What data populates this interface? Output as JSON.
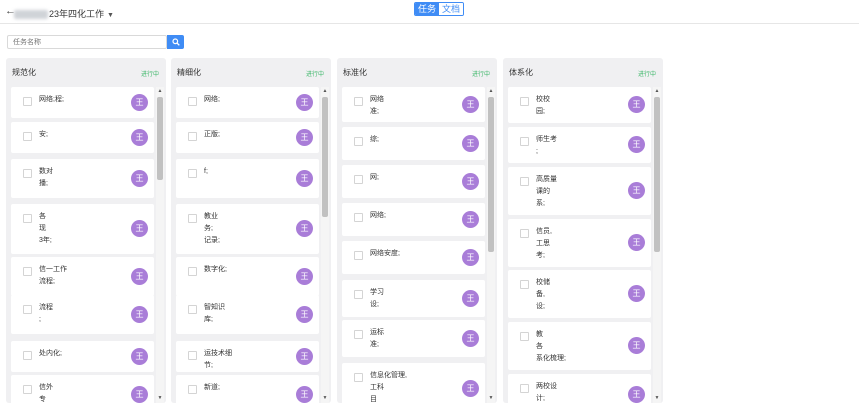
{
  "header": {
    "back_glyph": "←",
    "title_visible": "23年四化工作",
    "title_caret": "▼",
    "tabs": [
      {
        "label": "任务",
        "active": true
      },
      {
        "label": "文档",
        "active": false
      }
    ]
  },
  "search": {
    "placeholder": "任务名称",
    "button_icon": "search-icon"
  },
  "colors": {
    "accent": "#3f8cf5",
    "status_green": "#3fb86b",
    "avatar_purple": "#a97dd8",
    "column_bg": "#f0f0f2"
  },
  "columns": [
    {
      "title": "规范化",
      "status": "进行中",
      "cards": [
        {
          "lines": [
            "网络;程;"
          ],
          "avatar": "王"
        },
        {
          "lines": [
            "安;"
          ],
          "avatar": "王"
        },
        {
          "lines": [
            "数对",
            "播;"
          ],
          "avatar": "王"
        },
        {
          "lines": [
            "各",
            "现",
            "3年;"
          ],
          "avatar": "王"
        },
        {
          "lines": [
            "信一工作",
            "流程;"
          ],
          "avatar": "王"
        },
        {
          "lines": [
            "流程",
            ";"
          ],
          "avatar": "王"
        },
        {
          "lines": [
            "处内化;"
          ],
          "avatar": "王"
        },
        {
          "lines": [
            "信外",
            "专"
          ],
          "avatar": "王"
        }
      ]
    },
    {
      "title": "精细化",
      "status": "进行中",
      "cards": [
        {
          "lines": [
            "网络;"
          ],
          "avatar": "王"
        },
        {
          "lines": [
            "正版;"
          ],
          "avatar": "王"
        },
        {
          "lines": [
            "f;"
          ],
          "avatar": "王"
        },
        {
          "lines": [
            "教业",
            "务;",
            "记录;"
          ],
          "avatar": "王"
        },
        {
          "lines": [
            "数字化;"
          ],
          "avatar": "王"
        },
        {
          "lines": [
            "智知识",
            "库;"
          ],
          "avatar": "王"
        },
        {
          "lines": [
            "运技术细",
            "节;"
          ],
          "avatar": "王"
        },
        {
          "lines": [
            "新道;"
          ],
          "avatar": "王"
        }
      ]
    },
    {
      "title": "标准化",
      "status": "进行中",
      "cards": [
        {
          "lines": [
            "网络",
            "准;"
          ],
          "avatar": "王"
        },
        {
          "lines": [
            "综;"
          ],
          "avatar": "王"
        },
        {
          "lines": [
            "网;"
          ],
          "avatar": "王"
        },
        {
          "lines": [
            "网络;"
          ],
          "avatar": "王"
        },
        {
          "lines": [
            "网络安度;"
          ],
          "avatar": "王"
        },
        {
          "lines": [
            "学习",
            "设;"
          ],
          "avatar": "王"
        },
        {
          "lines": [
            "运标",
            "准;"
          ],
          "avatar": "王"
        },
        {
          "lines": [
            "信息化管理,",
            "工科",
            "目"
          ],
          "avatar": "王"
        }
      ]
    },
    {
      "title": "体系化",
      "status": "进行中",
      "cards": [
        {
          "lines": [
            "校校",
            "园;"
          ],
          "avatar": "王"
        },
        {
          "lines": [
            "师生考",
            ";"
          ],
          "avatar": "王"
        },
        {
          "lines": [
            "高质量",
            "课的",
            "系;"
          ],
          "avatar": "王"
        },
        {
          "lines": [
            "信员,",
            "工思",
            "考;"
          ],
          "avatar": "王"
        },
        {
          "lines": [
            "校储",
            "备,",
            "设;"
          ],
          "avatar": "王"
        },
        {
          "lines": [
            "教",
            "各",
            "系化梳理;"
          ],
          "avatar": "王"
        },
        {
          "lines": [
            "两校设",
            "计;"
          ],
          "avatar": "王"
        }
      ]
    }
  ]
}
